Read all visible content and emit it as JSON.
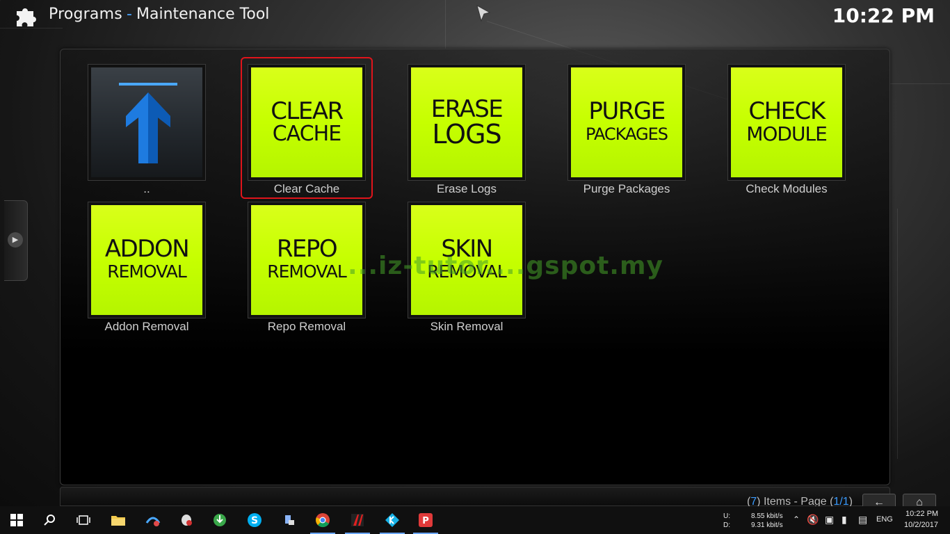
{
  "header": {
    "section": "Programs",
    "separator": "-",
    "title": "Maintenance Tool",
    "clock": "10:22 PM"
  },
  "tiles": [
    {
      "id": "up",
      "label": "..",
      "line1": "",
      "line2": ""
    },
    {
      "id": "clear-cache",
      "label": "Clear Cache",
      "line1": "CLEAR",
      "line2": "CACHE",
      "focused": true
    },
    {
      "id": "erase-logs",
      "label": "Erase Logs",
      "line1": "ERASE",
      "line2": "LOGS"
    },
    {
      "id": "purge-packages",
      "label": "Purge Packages",
      "line1": "PURGE",
      "line2": "PACKAGES"
    },
    {
      "id": "check-modules",
      "label": "Check Modules",
      "line1": "CHECK",
      "line2": "MODULE"
    },
    {
      "id": "addon-removal",
      "label": "Addon Removal",
      "line1": "ADDON",
      "line2": "REMOVAL"
    },
    {
      "id": "repo-removal",
      "label": "Repo Removal",
      "line1": "REPO",
      "line2": "REMOVAL"
    },
    {
      "id": "skin-removal",
      "label": "Skin Removal",
      "line1": "SKIN",
      "line2": "REMOVAL"
    }
  ],
  "watermark": "...iz-tutor....gspot.my",
  "footer": {
    "open_paren": "(",
    "count": "7",
    "items_text": ") Items - Page (",
    "page": "1/1",
    "close_paren": ")"
  },
  "taskbar": {
    "upload_label": "U:",
    "download_label": "D:",
    "upload_speed": "8.55 kbit/s",
    "download_speed": "9.31 kbit/s",
    "language": "ENG",
    "time": "10:22 PM",
    "date": "10/2/2017",
    "apps": [
      "windows-start",
      "search",
      "task-view",
      "file-explorer",
      "network-app",
      "mouse-app",
      "download-manager",
      "skype",
      "paint-app",
      "chrome",
      "gamepad-app",
      "kodi",
      "screen-recorder"
    ]
  },
  "colors": {
    "tile_yellow": "#c6ff00",
    "focus_red": "#e0141b",
    "accent_blue": "#3b9cff"
  }
}
